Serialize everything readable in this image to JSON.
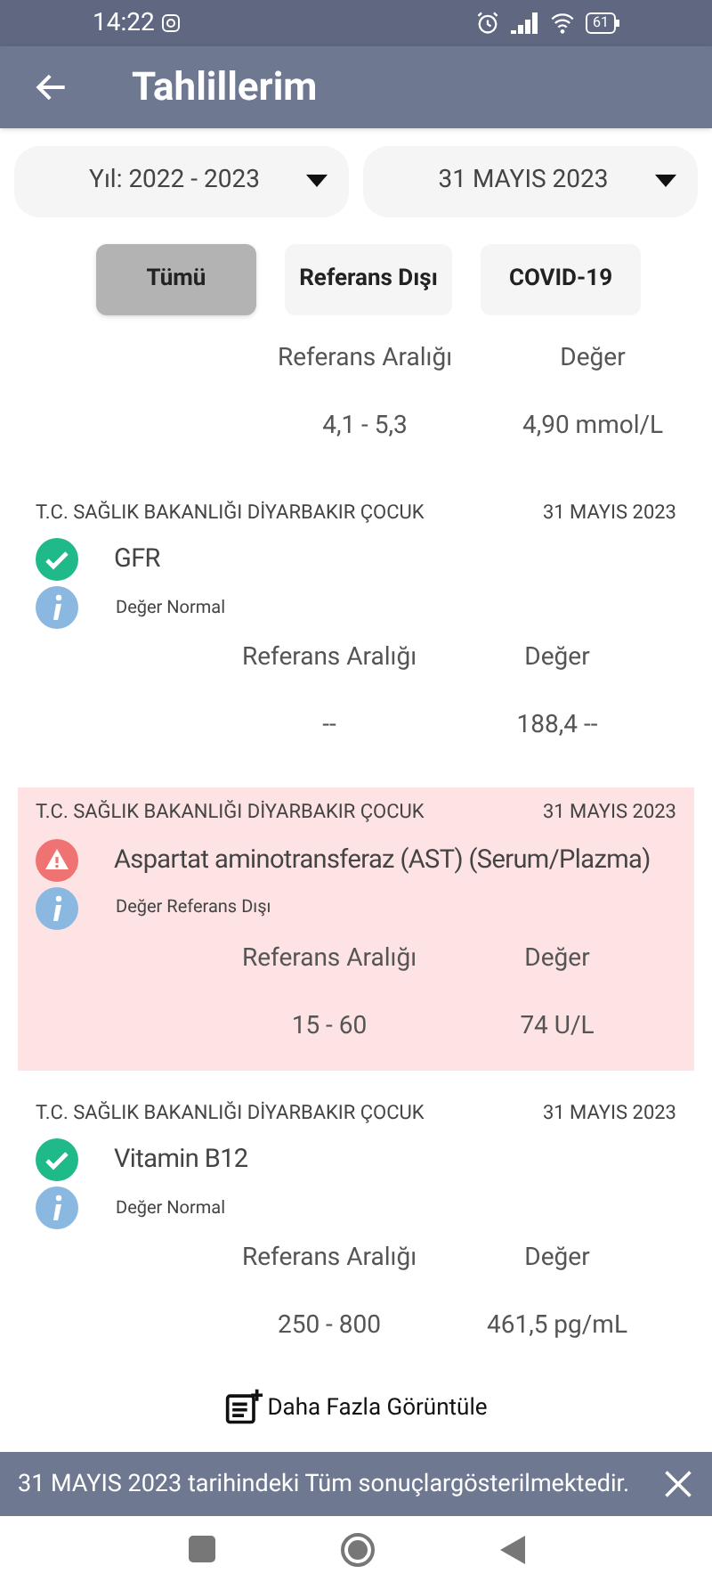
{
  "status_bar": {
    "time": "14:22",
    "battery": "61"
  },
  "header": {
    "title": "Tahlillerim"
  },
  "dropdowns": [
    {
      "label": "Yıl: 2022 - 2023"
    },
    {
      "label": "31 MAYIS 2023"
    }
  ],
  "filters": [
    {
      "label": "Tümü",
      "selected": true
    },
    {
      "label": "Referans Dışı",
      "selected": false
    },
    {
      "label": "COVID-19",
      "selected": false
    }
  ],
  "partial_result": {
    "range_label": "Referans Aralığı",
    "value_label": "Değer",
    "range": "4,1 - 5,3",
    "value": "4,90 mmol/L"
  },
  "results": [
    {
      "institution": "T.C. SAĞLIK BAKANLIĞI DİYARBAKIR ÇOCUK",
      "date": "31 MAYIS 2023",
      "name": "GFR",
      "kind": "normal",
      "note": "Değer Normal",
      "range_label": "Referans Aralığı",
      "value_label": "Değer",
      "range": "--",
      "value": "188,4 --"
    },
    {
      "institution": "T.C. SAĞLIK BAKANLIĞI DİYARBAKIR ÇOCUK",
      "date": "31 MAYIS 2023",
      "name": "Aspartat aminotransferaz (AST) (Serum/Plazma)",
      "kind": "out_of_range",
      "note": "Değer Referans Dışı",
      "range_label": "Referans Aralığı",
      "value_label": "Değer",
      "range": "15 - 60",
      "value": "74 U/L"
    },
    {
      "institution": "T.C. SAĞLIK BAKANLIĞI DİYARBAKIR ÇOCUK",
      "date": "31 MAYIS 2023",
      "name": "Vitamin B12",
      "kind": "normal",
      "note": "Değer Normal",
      "range_label": "Referans Aralığı",
      "value_label": "Değer",
      "range": "250 - 800",
      "value": "461,5 pg/mL"
    }
  ],
  "more_button": {
    "label": "Daha Fazla Görüntüle"
  },
  "snackbar": {
    "message": "31 MAYIS 2023 tarihindeki Tüm sonuçlargösterilmektedir."
  }
}
